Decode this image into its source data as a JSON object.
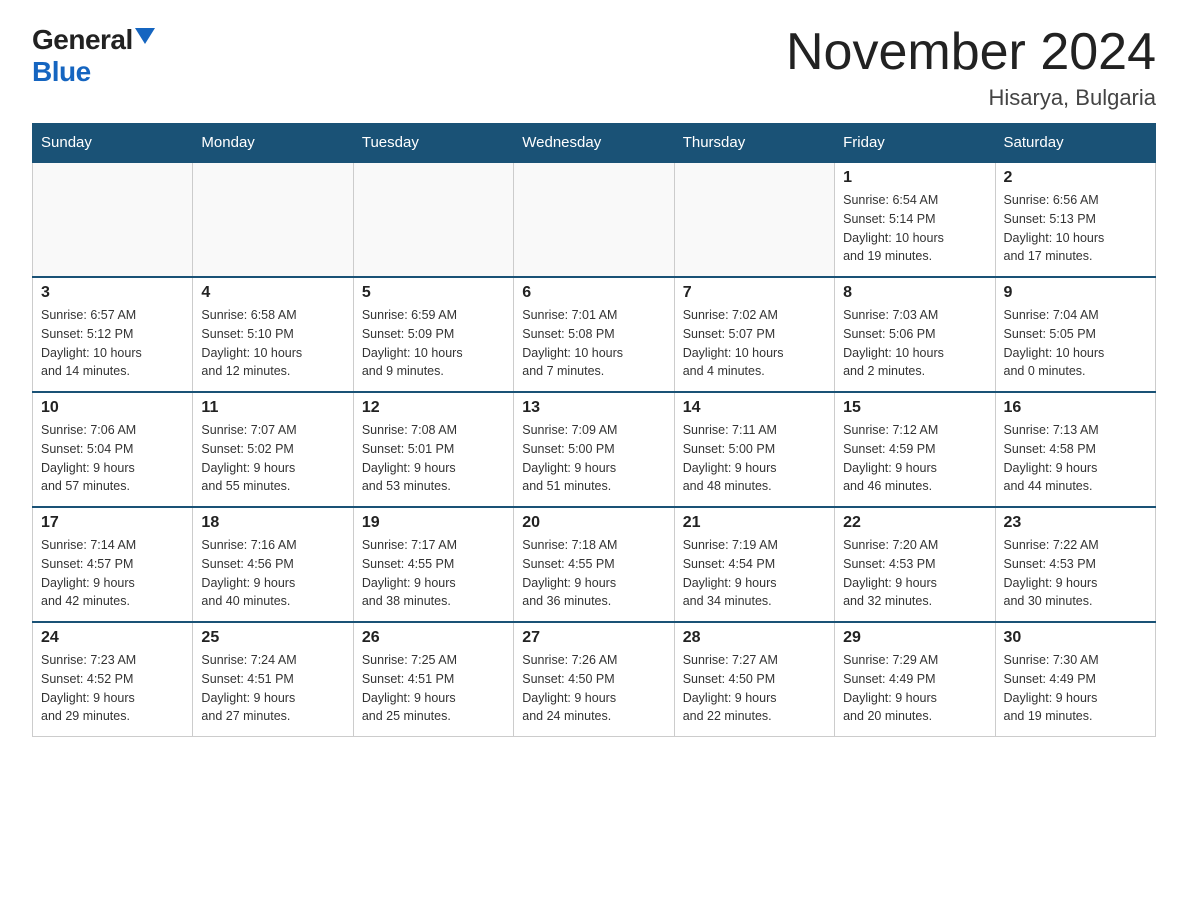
{
  "logo": {
    "general": "General",
    "blue": "Blue"
  },
  "title": "November 2024",
  "location": "Hisarya, Bulgaria",
  "weekdays": [
    "Sunday",
    "Monday",
    "Tuesday",
    "Wednesday",
    "Thursday",
    "Friday",
    "Saturday"
  ],
  "weeks": [
    [
      {
        "day": "",
        "info": ""
      },
      {
        "day": "",
        "info": ""
      },
      {
        "day": "",
        "info": ""
      },
      {
        "day": "",
        "info": ""
      },
      {
        "day": "",
        "info": ""
      },
      {
        "day": "1",
        "info": "Sunrise: 6:54 AM\nSunset: 5:14 PM\nDaylight: 10 hours\nand 19 minutes."
      },
      {
        "day": "2",
        "info": "Sunrise: 6:56 AM\nSunset: 5:13 PM\nDaylight: 10 hours\nand 17 minutes."
      }
    ],
    [
      {
        "day": "3",
        "info": "Sunrise: 6:57 AM\nSunset: 5:12 PM\nDaylight: 10 hours\nand 14 minutes."
      },
      {
        "day": "4",
        "info": "Sunrise: 6:58 AM\nSunset: 5:10 PM\nDaylight: 10 hours\nand 12 minutes."
      },
      {
        "day": "5",
        "info": "Sunrise: 6:59 AM\nSunset: 5:09 PM\nDaylight: 10 hours\nand 9 minutes."
      },
      {
        "day": "6",
        "info": "Sunrise: 7:01 AM\nSunset: 5:08 PM\nDaylight: 10 hours\nand 7 minutes."
      },
      {
        "day": "7",
        "info": "Sunrise: 7:02 AM\nSunset: 5:07 PM\nDaylight: 10 hours\nand 4 minutes."
      },
      {
        "day": "8",
        "info": "Sunrise: 7:03 AM\nSunset: 5:06 PM\nDaylight: 10 hours\nand 2 minutes."
      },
      {
        "day": "9",
        "info": "Sunrise: 7:04 AM\nSunset: 5:05 PM\nDaylight: 10 hours\nand 0 minutes."
      }
    ],
    [
      {
        "day": "10",
        "info": "Sunrise: 7:06 AM\nSunset: 5:04 PM\nDaylight: 9 hours\nand 57 minutes."
      },
      {
        "day": "11",
        "info": "Sunrise: 7:07 AM\nSunset: 5:02 PM\nDaylight: 9 hours\nand 55 minutes."
      },
      {
        "day": "12",
        "info": "Sunrise: 7:08 AM\nSunset: 5:01 PM\nDaylight: 9 hours\nand 53 minutes."
      },
      {
        "day": "13",
        "info": "Sunrise: 7:09 AM\nSunset: 5:00 PM\nDaylight: 9 hours\nand 51 minutes."
      },
      {
        "day": "14",
        "info": "Sunrise: 7:11 AM\nSunset: 5:00 PM\nDaylight: 9 hours\nand 48 minutes."
      },
      {
        "day": "15",
        "info": "Sunrise: 7:12 AM\nSunset: 4:59 PM\nDaylight: 9 hours\nand 46 minutes."
      },
      {
        "day": "16",
        "info": "Sunrise: 7:13 AM\nSunset: 4:58 PM\nDaylight: 9 hours\nand 44 minutes."
      }
    ],
    [
      {
        "day": "17",
        "info": "Sunrise: 7:14 AM\nSunset: 4:57 PM\nDaylight: 9 hours\nand 42 minutes."
      },
      {
        "day": "18",
        "info": "Sunrise: 7:16 AM\nSunset: 4:56 PM\nDaylight: 9 hours\nand 40 minutes."
      },
      {
        "day": "19",
        "info": "Sunrise: 7:17 AM\nSunset: 4:55 PM\nDaylight: 9 hours\nand 38 minutes."
      },
      {
        "day": "20",
        "info": "Sunrise: 7:18 AM\nSunset: 4:55 PM\nDaylight: 9 hours\nand 36 minutes."
      },
      {
        "day": "21",
        "info": "Sunrise: 7:19 AM\nSunset: 4:54 PM\nDaylight: 9 hours\nand 34 minutes."
      },
      {
        "day": "22",
        "info": "Sunrise: 7:20 AM\nSunset: 4:53 PM\nDaylight: 9 hours\nand 32 minutes."
      },
      {
        "day": "23",
        "info": "Sunrise: 7:22 AM\nSunset: 4:53 PM\nDaylight: 9 hours\nand 30 minutes."
      }
    ],
    [
      {
        "day": "24",
        "info": "Sunrise: 7:23 AM\nSunset: 4:52 PM\nDaylight: 9 hours\nand 29 minutes."
      },
      {
        "day": "25",
        "info": "Sunrise: 7:24 AM\nSunset: 4:51 PM\nDaylight: 9 hours\nand 27 minutes."
      },
      {
        "day": "26",
        "info": "Sunrise: 7:25 AM\nSunset: 4:51 PM\nDaylight: 9 hours\nand 25 minutes."
      },
      {
        "day": "27",
        "info": "Sunrise: 7:26 AM\nSunset: 4:50 PM\nDaylight: 9 hours\nand 24 minutes."
      },
      {
        "day": "28",
        "info": "Sunrise: 7:27 AM\nSunset: 4:50 PM\nDaylight: 9 hours\nand 22 minutes."
      },
      {
        "day": "29",
        "info": "Sunrise: 7:29 AM\nSunset: 4:49 PM\nDaylight: 9 hours\nand 20 minutes."
      },
      {
        "day": "30",
        "info": "Sunrise: 7:30 AM\nSunset: 4:49 PM\nDaylight: 9 hours\nand 19 minutes."
      }
    ]
  ]
}
